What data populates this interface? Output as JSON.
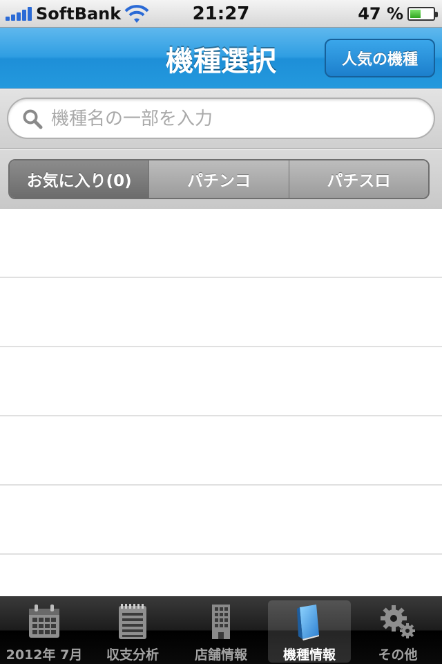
{
  "status_bar": {
    "carrier": "SoftBank",
    "time": "21:27",
    "battery_percent": "47 %",
    "battery_level": 0.47,
    "icons": [
      "signal-bars-icon",
      "wifi-icon",
      "battery-icon"
    ]
  },
  "nav_bar": {
    "title": "機種選択",
    "right_button": "人気の機種"
  },
  "search": {
    "placeholder": "機種名の一部を入力",
    "value": ""
  },
  "segments": [
    {
      "label": "お気に入り(0)",
      "selected": true
    },
    {
      "label": "パチンコ",
      "selected": false
    },
    {
      "label": "パチスロ",
      "selected": false
    }
  ],
  "tab_bar": {
    "items": [
      {
        "label": "2012年 7月",
        "icon": "calendar-icon",
        "active": false
      },
      {
        "label": "収支分析",
        "icon": "notepad-icon",
        "active": false
      },
      {
        "label": "店舗情報",
        "icon": "building-icon",
        "active": false
      },
      {
        "label": "機種情報",
        "icon": "book-icon",
        "active": true
      },
      {
        "label": "その他",
        "icon": "gears-icon",
        "active": false
      }
    ]
  },
  "colors": {
    "nav_blue": "#2f9ee2",
    "tab_bar": "#1c1c1c",
    "battery_green": "#2fa51e"
  }
}
